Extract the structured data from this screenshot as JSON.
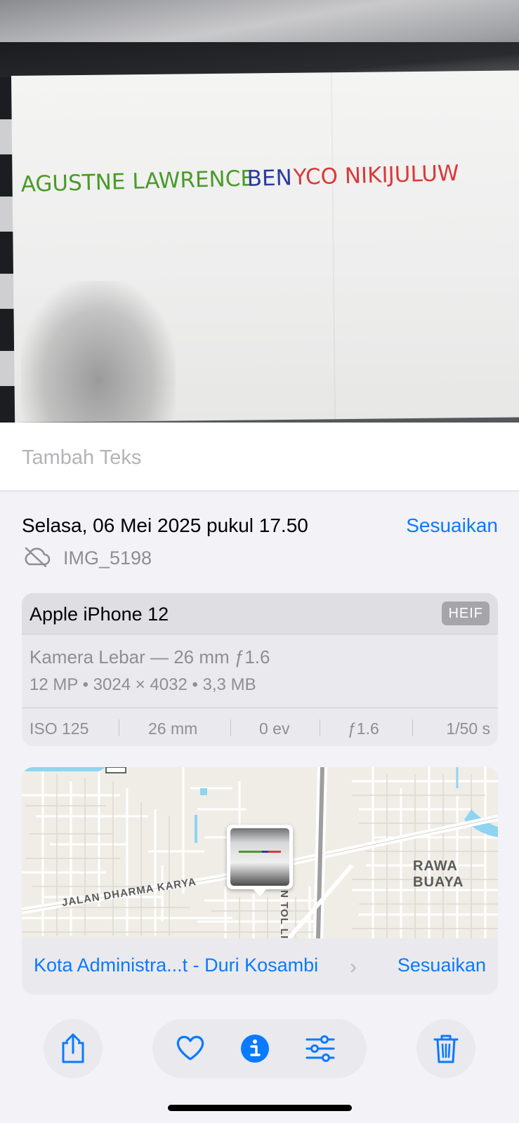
{
  "photo": {
    "handwriting_segments": [
      {
        "text": "AGUSTNE LAWRENCE",
        "color": "#4a9a2a"
      },
      {
        "text": "BEN",
        "color": "#2c3a9c"
      },
      {
        "text": "YCO NIKIJULUW",
        "color": "#d83a3a"
      }
    ]
  },
  "caption": {
    "placeholder": "Tambah Teks"
  },
  "info": {
    "date": "Selasa, 06 Mei 2025 pukul 17.50",
    "adjust_label": "Sesuaikan",
    "cloud_icon": "cloud-off-icon",
    "filename": "IMG_5198"
  },
  "camera": {
    "device": "Apple iPhone 12",
    "format": "HEIF",
    "lens": "Kamera Lebar — 26 mm ƒ1.6",
    "specs": "12 MP • 3024 × 4032 • 3,3 MB",
    "exif": [
      "ISO 125",
      "26 mm",
      "0 ev",
      "ƒ1.6",
      "1/50 s"
    ]
  },
  "map": {
    "labels": {
      "road_1": "JALAN DHARMA KARYA",
      "road_2": "JALAN TOL LI",
      "area": "RAWA BUAYA"
    },
    "location": "Kota Administra...t - Duri Kosambi",
    "adjust_label": "Sesuaikan"
  },
  "toolbar": {
    "icons": [
      "share-icon",
      "heart-icon",
      "info-icon",
      "adjust-sliders-icon",
      "trash-icon"
    ],
    "accent": "#0a7aff"
  }
}
